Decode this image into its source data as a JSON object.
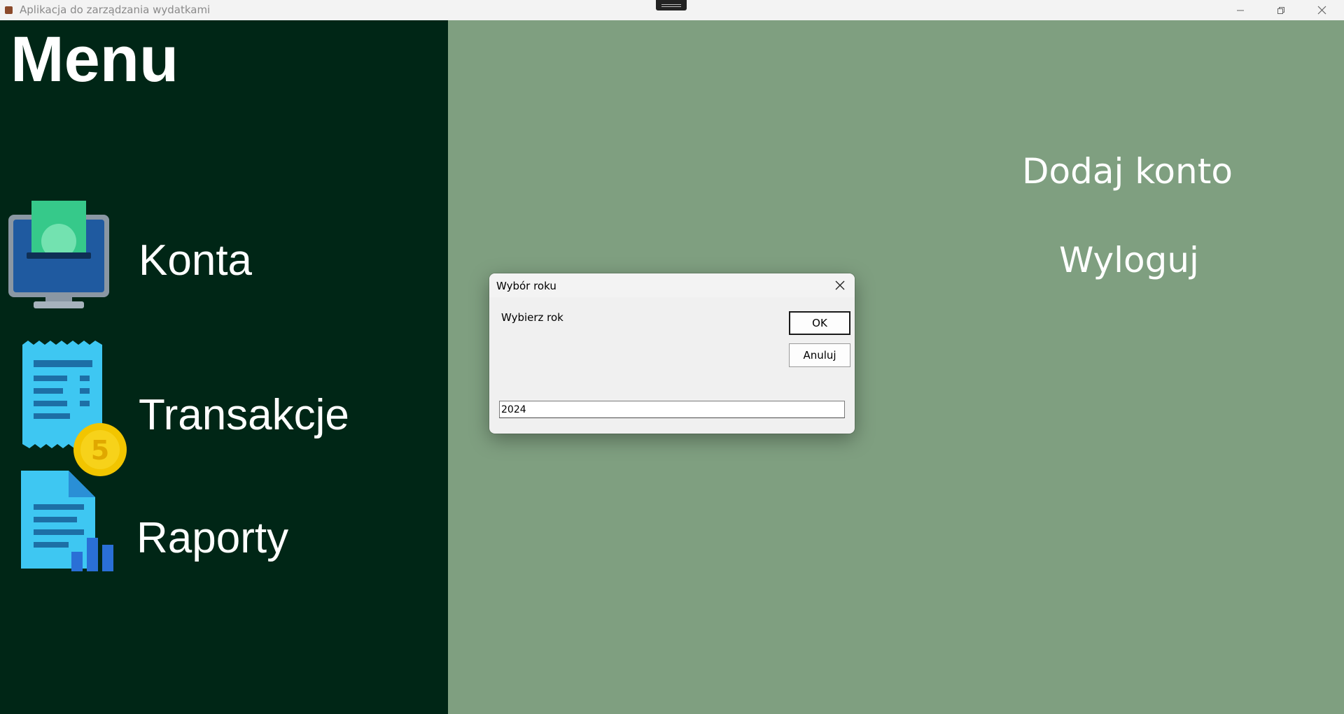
{
  "window": {
    "title": "Aplikacja do zarządzania wydatkami",
    "controls": [
      "minimize",
      "restore",
      "close"
    ]
  },
  "sidebar": {
    "title": "Menu",
    "items": [
      {
        "label": "Konta",
        "icon": "accounts-monitor-cash-icon"
      },
      {
        "label": "Transakcje",
        "icon": "receipt-coin-icon"
      },
      {
        "label": "Raporty",
        "icon": "report-document-chart-icon"
      }
    ]
  },
  "main": {
    "links": {
      "add_account": "Dodaj konto",
      "logout": "Wyloguj"
    }
  },
  "dialog": {
    "title": "Wybór roku",
    "prompt": "Wybierz rok",
    "ok_label": "OK",
    "cancel_label": "Anuluj",
    "input_value": "2024"
  },
  "colors": {
    "sidebar_bg": "#002616",
    "main_bg": "#7f9f80",
    "text": "#ffffff"
  }
}
